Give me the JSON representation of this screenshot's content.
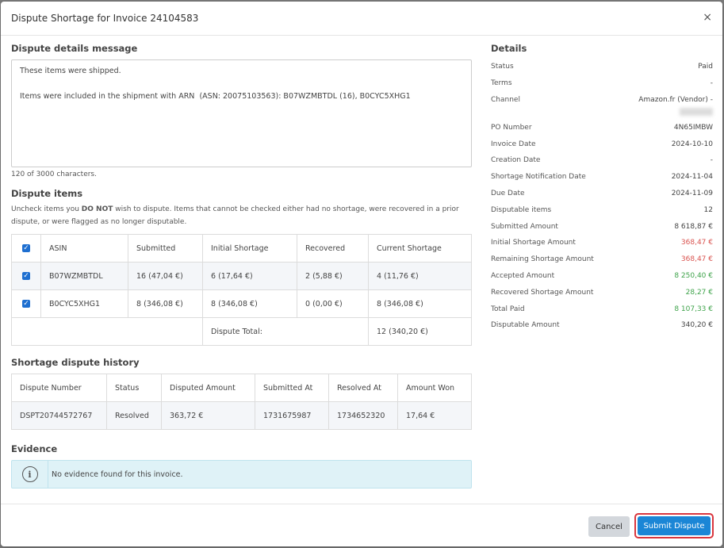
{
  "modal": {
    "title": "Dispute Shortage for Invoice 24104583",
    "close_glyph": "×"
  },
  "message": {
    "heading": "Dispute details message",
    "text": "These items were shipped.\n\nItems were included in the shipment with ARN  (ASN: 20075103563): B07WZMBTDL (16), B0CYC5XHG1",
    "char_count": "120 of 3000 characters."
  },
  "items": {
    "heading": "Dispute items",
    "help_pre": "Uncheck items you ",
    "help_bold": "DO NOT",
    "help_post": " wish to dispute. Items that cannot be checked either had no shortage, were recovered in a prior dispute, or were flagged as no longer disputable.",
    "columns": [
      "ASIN",
      "Submitted",
      "Initial Shortage",
      "Recovered",
      "Current Shortage"
    ],
    "rows": [
      {
        "asin": "B07WZMBTDL",
        "submitted": "16 (47,04 €)",
        "initial": "6 (17,64 €)",
        "recovered": "2 (5,88 €)",
        "current": "4 (11,76 €)"
      },
      {
        "asin": "B0CYC5XHG1",
        "submitted": "8 (346,08 €)",
        "initial": "8 (346,08 €)",
        "recovered": "0 (0,00 €)",
        "current": "8 (346,08 €)"
      }
    ],
    "total_label": "Dispute Total:",
    "total_value": "12 (340,20 €)"
  },
  "history": {
    "heading": "Shortage dispute history",
    "columns": [
      "Dispute Number",
      "Status",
      "Disputed Amount",
      "Submitted At",
      "Resolved At",
      "Amount Won"
    ],
    "rows": [
      [
        "DSPT20744572767",
        "Resolved",
        "363,72 €",
        "1731675987",
        "1734652320",
        "17,64 €"
      ]
    ]
  },
  "evidence": {
    "heading": "Evidence",
    "icon": "info-icon",
    "empty_text": "No evidence found for this invoice."
  },
  "details": {
    "heading": "Details",
    "rows_top": [
      {
        "label": "Status",
        "value": "Paid"
      },
      {
        "label": "Terms",
        "value": "-"
      },
      {
        "label": "Channel",
        "value": "Amazon.fr (Vendor) -"
      }
    ],
    "rows_bottom": [
      {
        "label": "PO Number",
        "value": "4N65IMBW"
      },
      {
        "label": "Invoice Date",
        "value": "2024-10-10"
      },
      {
        "label": "Creation Date",
        "value": "-"
      },
      {
        "label": "Shortage Notification Date",
        "value": "2024-11-04"
      },
      {
        "label": "Due Date",
        "value": "2024-11-09"
      },
      {
        "label": "Disputable items",
        "value": "12"
      },
      {
        "label": "Submitted Amount",
        "value": "8 618,87 €"
      },
      {
        "label": "Initial Shortage Amount",
        "value": "368,47 €",
        "color": "red"
      },
      {
        "label": "Remaining Shortage Amount",
        "value": "368,47 €",
        "color": "red"
      },
      {
        "label": "Accepted Amount",
        "value": "8 250,40 €",
        "color": "green"
      },
      {
        "label": "Recovered Shortage Amount",
        "value": "28,27 €",
        "color": "green"
      },
      {
        "label": "Total Paid",
        "value": "8 107,33 €",
        "color": "green"
      },
      {
        "label": "Disputable Amount",
        "value": "340,20 €"
      }
    ]
  },
  "footer": {
    "cancel_label": "Cancel",
    "submit_label": "Submit Dispute"
  },
  "colors": {
    "primary": "#1b86d6",
    "highlight": "#d9363e",
    "negative": "#d9534f",
    "positive": "#3ea34a",
    "info_bg": "#dff2f7"
  }
}
